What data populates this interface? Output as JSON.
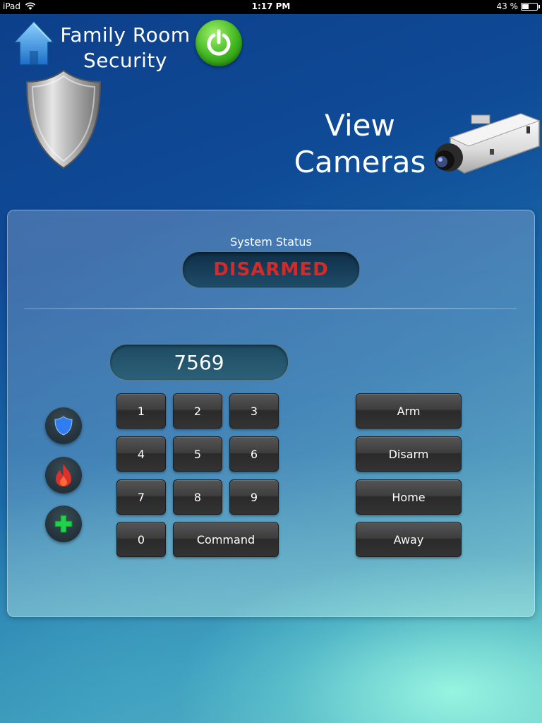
{
  "status_bar": {
    "device": "iPad",
    "time": "1:17 PM",
    "battery_percent": "43 %",
    "battery_level": 0.43
  },
  "header": {
    "title_line1": "Family Room",
    "title_line2": "Security",
    "view_cameras_line1": "View",
    "view_cameras_line2": "Cameras"
  },
  "panel": {
    "status_label": "System Status",
    "status_value": "DISARMED",
    "status_color": "#d42a2a",
    "code_display": "7569"
  },
  "keypad": {
    "k1": "1",
    "k2": "2",
    "k3": "3",
    "k4": "4",
    "k5": "5",
    "k6": "6",
    "k7": "7",
    "k8": "8",
    "k9": "9",
    "k0": "0",
    "command": "Command"
  },
  "modes": {
    "arm": "Arm",
    "disarm": "Disarm",
    "home": "Home",
    "away": "Away"
  },
  "side_buttons": {
    "police": "police-shield-icon",
    "fire": "fire-icon",
    "medical": "medical-cross-icon"
  }
}
